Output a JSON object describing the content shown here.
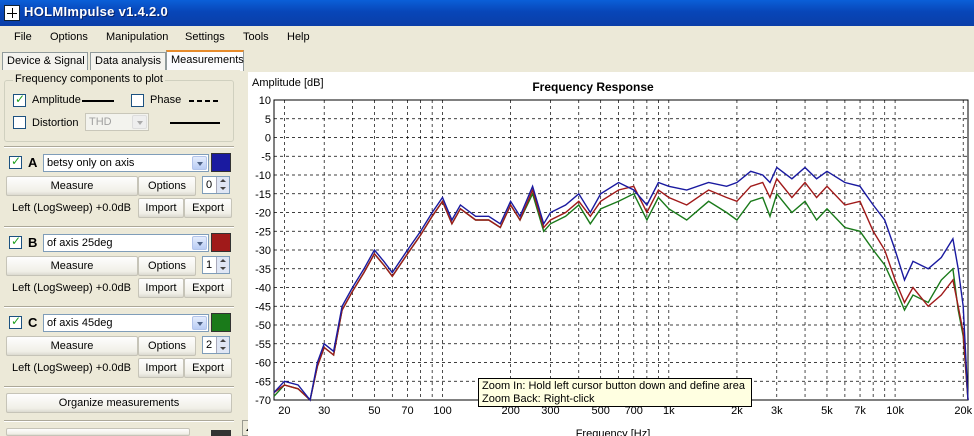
{
  "window": {
    "title": "HOLMImpulse  v1.4.2.0"
  },
  "menu": [
    "File",
    "Options",
    "Manipulation",
    "Settings",
    "Tools",
    "Help"
  ],
  "tabs": [
    "Device & Signal",
    "Data analysis",
    "Measurements"
  ],
  "freq_components": {
    "title": "Frequency components to plot",
    "amplitude": "Amplitude",
    "phase": "Phase",
    "distortion": "Distortion",
    "distortion_type": "THD"
  },
  "measurements": [
    {
      "letter": "A",
      "name": "betsy only on axis",
      "color": "#1a1aa0",
      "measure": "Measure",
      "options": "Options",
      "spin": "0",
      "info": "Left (LogSweep) +0.0dB",
      "import": "Import",
      "export": "Export"
    },
    {
      "letter": "B",
      "name": "of axis 25deg",
      "color": "#a01a1a",
      "measure": "Measure",
      "options": "Options",
      "spin": "1",
      "info": "Left (LogSweep) +0.0dB",
      "import": "Import",
      "export": "Export"
    },
    {
      "letter": "C",
      "name": "of axis 45deg",
      "color": "#1a7a1a",
      "measure": "Measure",
      "options": "Options",
      "spin": "2",
      "info": "Left (LogSweep) +0.0dB",
      "import": "Import",
      "export": "Export"
    }
  ],
  "organize_button": "Organize measurements",
  "tooltip": {
    "line1": "Zoom In:   Hold left cursor button down and define area",
    "line2": "Zoom Back: Right-click"
  },
  "chart_data": {
    "type": "line",
    "title": "Frequency Response",
    "xlabel": "Frequency [Hz]",
    "ylabel": "Amplitude [dB]",
    "xscale": "log",
    "xlim": [
      18,
      21000
    ],
    "ylim": [
      -70,
      10
    ],
    "x_ticks": [
      20,
      30,
      50,
      70,
      100,
      200,
      300,
      500,
      700,
      1000,
      2000,
      3000,
      5000,
      7000,
      10000,
      20000
    ],
    "x_tick_labels": [
      "20",
      "30",
      "50",
      "70",
      "100",
      "200",
      "300",
      "500",
      "700",
      "1k",
      "2k",
      "3k",
      "5k",
      "7k",
      "10k",
      "20k"
    ],
    "y_ticks": [
      10,
      5,
      0,
      -5,
      -10,
      -15,
      -20,
      -25,
      -30,
      -35,
      -40,
      -45,
      -50,
      -55,
      -60,
      -65,
      -70
    ],
    "grid": true,
    "series": [
      {
        "color": "#1a1aa0",
        "x": [
          18,
          20,
          23,
          26,
          28,
          30,
          33,
          36,
          40,
          45,
          50,
          55,
          60,
          70,
          80,
          90,
          100,
          110,
          120,
          140,
          160,
          180,
          200,
          220,
          250,
          280,
          300,
          350,
          400,
          450,
          500,
          600,
          700,
          800,
          900,
          1000,
          1200,
          1500,
          1800,
          2000,
          2300,
          2600,
          2800,
          3000,
          3500,
          4000,
          4500,
          5000,
          6000,
          7000,
          8000,
          9000,
          10000,
          11000,
          12000,
          14000,
          16000,
          18000,
          19000,
          20000,
          21000
        ],
        "y": [
          -68,
          -65,
          -66,
          -70,
          -60,
          -55,
          -57,
          -45,
          -40,
          -35,
          -30,
          -33,
          -36,
          -30,
          -25,
          -20,
          -16,
          -22,
          -18,
          -21,
          -21,
          -23,
          -17,
          -21,
          -13,
          -23,
          -20,
          -18,
          -15,
          -20,
          -15,
          -12,
          -14,
          -18,
          -12,
          -13,
          -14,
          -12,
          -13,
          -12,
          -9,
          -10,
          -12,
          -8,
          -11,
          -8,
          -11,
          -9,
          -12,
          -13,
          -18,
          -22,
          -30,
          -38,
          -33,
          -35,
          -32,
          -27,
          -35,
          -45,
          -70
        ]
      },
      {
        "color": "#a01a1a",
        "x": [
          18,
          20,
          23,
          26,
          28,
          30,
          33,
          36,
          40,
          45,
          50,
          55,
          60,
          70,
          80,
          90,
          100,
          110,
          120,
          140,
          160,
          180,
          200,
          220,
          250,
          280,
          300,
          350,
          400,
          450,
          500,
          600,
          700,
          800,
          900,
          1000,
          1200,
          1500,
          1800,
          2000,
          2300,
          2600,
          2800,
          3000,
          3500,
          4000,
          4500,
          5000,
          6000,
          7000,
          8000,
          9000,
          10000,
          11000,
          12000,
          14000,
          16000,
          18000,
          19000,
          20000,
          21000
        ],
        "y": [
          -68,
          -66,
          -67,
          -70,
          -61,
          -56,
          -58,
          -46,
          -41,
          -36,
          -31,
          -34,
          -37,
          -31,
          -26,
          -21,
          -17,
          -23,
          -19,
          -22,
          -22,
          -24,
          -18,
          -22,
          -14,
          -24,
          -22,
          -20,
          -17,
          -21,
          -17,
          -14,
          -13,
          -20,
          -14,
          -16,
          -18,
          -14,
          -16,
          -17,
          -13,
          -12,
          -16,
          -11,
          -16,
          -12,
          -16,
          -13,
          -18,
          -17,
          -25,
          -30,
          -38,
          -44,
          -40,
          -45,
          -42,
          -38,
          -45,
          -52,
          -70
        ]
      },
      {
        "color": "#1a7a1a",
        "x": [
          18,
          20,
          23,
          26,
          28,
          30,
          33,
          36,
          40,
          45,
          50,
          55,
          60,
          70,
          80,
          90,
          100,
          110,
          120,
          140,
          160,
          180,
          200,
          220,
          250,
          280,
          300,
          350,
          400,
          450,
          500,
          600,
          700,
          800,
          900,
          1000,
          1200,
          1500,
          1800,
          2000,
          2300,
          2600,
          2800,
          3000,
          3500,
          4000,
          4500,
          5000,
          6000,
          7000,
          8000,
          9000,
          10000,
          11000,
          12000,
          14000,
          16000,
          18000,
          19000,
          20000,
          21000
        ],
        "y": [
          -69,
          -66,
          -67,
          -70,
          -61,
          -56,
          -58,
          -46,
          -41,
          -36,
          -31,
          -34,
          -37,
          -31,
          -26,
          -21,
          -17,
          -23,
          -19,
          -22,
          -22,
          -24,
          -18,
          -22,
          -15,
          -25,
          -23,
          -21,
          -18,
          -23,
          -19,
          -17,
          -15,
          -22,
          -16,
          -19,
          -22,
          -17,
          -20,
          -22,
          -17,
          -16,
          -21,
          -15,
          -20,
          -17,
          -22,
          -19,
          -24,
          -25,
          -30,
          -34,
          -40,
          -46,
          -42,
          -44,
          -38,
          -35,
          -46,
          -53,
          -70
        ]
      }
    ]
  }
}
